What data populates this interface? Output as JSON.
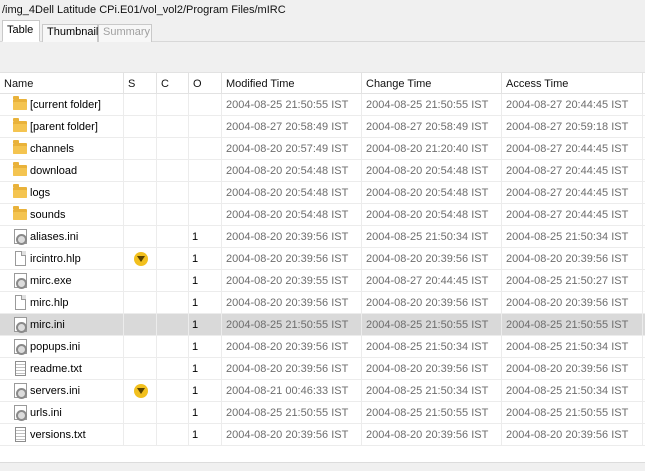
{
  "path": "/img_4Dell Latitude CPi.E01/vol_vol2/Program Files/mIRC",
  "tabs": [
    {
      "label": "Table",
      "active": true
    },
    {
      "label": "Thumbnail",
      "active": false
    },
    {
      "label": "Summary",
      "active": false,
      "disabled": true
    }
  ],
  "columns": {
    "name": "Name",
    "s": "S",
    "c": "C",
    "o": "O",
    "modified": "Modified Time",
    "change": "Change Time",
    "access": "Access Time"
  },
  "rows": [
    {
      "icon": "folder-icon",
      "name": "[current folder]",
      "s": "",
      "o": "",
      "modified": "2004-08-25 21:50:55 IST",
      "change": "2004-08-25 21:50:55 IST",
      "access": "2004-08-27 20:44:45 IST"
    },
    {
      "icon": "folder-icon",
      "name": "[parent folder]",
      "s": "",
      "o": "",
      "modified": "2004-08-27 20:58:49 IST",
      "change": "2004-08-27 20:58:49 IST",
      "access": "2004-08-27 20:59:18 IST"
    },
    {
      "icon": "folder-icon",
      "name": "channels",
      "s": "",
      "o": "",
      "modified": "2004-08-20 20:57:49 IST",
      "change": "2004-08-20 21:20:40 IST",
      "access": "2004-08-27 20:44:45 IST"
    },
    {
      "icon": "folder-icon",
      "name": "download",
      "s": "",
      "o": "",
      "modified": "2004-08-20 20:54:48 IST",
      "change": "2004-08-20 20:54:48 IST",
      "access": "2004-08-27 20:44:45 IST"
    },
    {
      "icon": "folder-icon",
      "name": "logs",
      "s": "",
      "o": "",
      "modified": "2004-08-20 20:54:48 IST",
      "change": "2004-08-20 20:54:48 IST",
      "access": "2004-08-27 20:44:45 IST"
    },
    {
      "icon": "folder-icon",
      "name": "sounds",
      "s": "",
      "o": "",
      "modified": "2004-08-20 20:54:48 IST",
      "change": "2004-08-20 20:54:48 IST",
      "access": "2004-08-27 20:44:45 IST"
    },
    {
      "icon": "settings-file-icon",
      "name": "aliases.ini",
      "s": "",
      "o": "1",
      "modified": "2004-08-20 20:39:56 IST",
      "change": "2004-08-25 21:50:34 IST",
      "access": "2004-08-25 21:50:34 IST"
    },
    {
      "icon": "document-icon",
      "name": "ircintro.hlp",
      "s": "warning",
      "o": "1",
      "modified": "2004-08-20 20:39:56 IST",
      "change": "2004-08-20 20:39:56 IST",
      "access": "2004-08-20 20:39:56 IST"
    },
    {
      "icon": "settings-file-icon",
      "name": "mirc.exe",
      "s": "",
      "o": "1",
      "modified": "2004-08-20 20:39:55 IST",
      "change": "2004-08-27 20:44:45 IST",
      "access": "2004-08-25 21:50:27 IST"
    },
    {
      "icon": "document-icon",
      "name": "mirc.hlp",
      "s": "",
      "o": "1",
      "modified": "2004-08-20 20:39:56 IST",
      "change": "2004-08-20 20:39:56 IST",
      "access": "2004-08-20 20:39:56 IST"
    },
    {
      "icon": "settings-file-icon",
      "name": "mirc.ini",
      "s": "",
      "o": "1",
      "modified": "2004-08-25 21:50:55 IST",
      "change": "2004-08-25 21:50:55 IST",
      "access": "2004-08-25 21:50:55 IST",
      "selected": true
    },
    {
      "icon": "settings-file-icon",
      "name": "popups.ini",
      "s": "",
      "o": "1",
      "modified": "2004-08-20 20:39:56 IST",
      "change": "2004-08-25 21:50:34 IST",
      "access": "2004-08-25 21:50:34 IST"
    },
    {
      "icon": "text-file-icon",
      "name": "readme.txt",
      "s": "",
      "o": "1",
      "modified": "2004-08-20 20:39:56 IST",
      "change": "2004-08-20 20:39:56 IST",
      "access": "2004-08-20 20:39:56 IST"
    },
    {
      "icon": "settings-file-icon",
      "name": "servers.ini",
      "s": "warning",
      "o": "1",
      "modified": "2004-08-21 00:46:33 IST",
      "change": "2004-08-25 21:50:34 IST",
      "access": "2004-08-25 21:50:34 IST"
    },
    {
      "icon": "settings-file-icon",
      "name": "urls.ini",
      "s": "",
      "o": "1",
      "modified": "2004-08-25 21:50:55 IST",
      "change": "2004-08-25 21:50:55 IST",
      "access": "2004-08-25 21:50:55 IST"
    },
    {
      "icon": "text-file-icon",
      "name": "versions.txt",
      "s": "",
      "o": "1",
      "modified": "2004-08-20 20:39:56 IST",
      "change": "2004-08-20 20:39:56 IST",
      "access": "2004-08-20 20:39:56 IST"
    }
  ]
}
